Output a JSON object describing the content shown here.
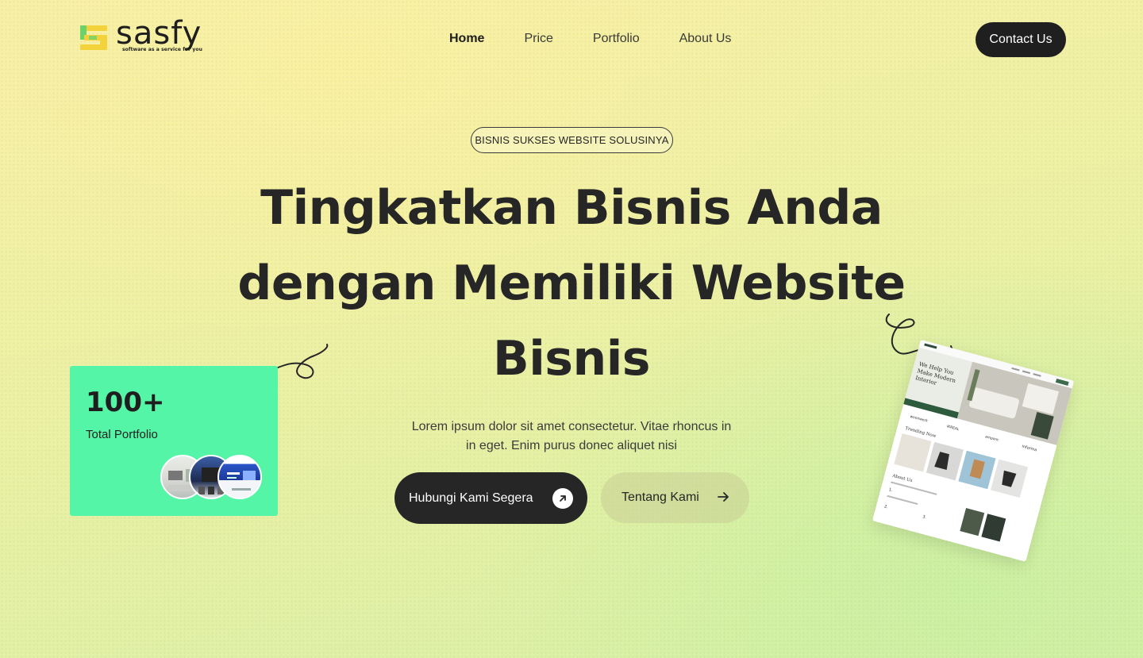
{
  "brand": {
    "name": "sasfy",
    "tagline": "software as a service for you",
    "colors": {
      "yellow": "#f4d23c",
      "green": "#6cd36a"
    }
  },
  "nav": {
    "items": [
      {
        "label": "Home",
        "active": true
      },
      {
        "label": "Price",
        "active": false
      },
      {
        "label": "Portfolio",
        "active": false
      },
      {
        "label": "About Us",
        "active": false
      }
    ],
    "contact_label": "Contact Us"
  },
  "hero": {
    "badge": "BISNIS SUKSES WEBSITE SOLUSINYA",
    "headline_line1": "Tingkatkan Bisnis Anda",
    "headline_line2": "dengan Memiliki Website",
    "headline_line3": "Bisnis",
    "subtext_line1": "Lorem ipsum dolor sit amet consectetur. Vitae rhoncus in",
    "subtext_line2": "in eget. Enim purus donec aliquet nisi",
    "primary_button": "Hubungi Kami Segera",
    "secondary_button": "Tentang Kami"
  },
  "portfolio_card": {
    "count": "100+",
    "label": "Total Portfolio",
    "accent": "#55f5a7"
  },
  "mockup": {
    "hero_text": "We Help You Make Modern Interior",
    "section_title": "Trending Now",
    "about_title": "About Us",
    "brands": [
      "woonwerk",
      "IKREAL",
      "ampare",
      "informa"
    ]
  },
  "icons": [
    "arrow-up-right-icon",
    "arrow-right-icon",
    "squiggle-arrow-icon"
  ]
}
